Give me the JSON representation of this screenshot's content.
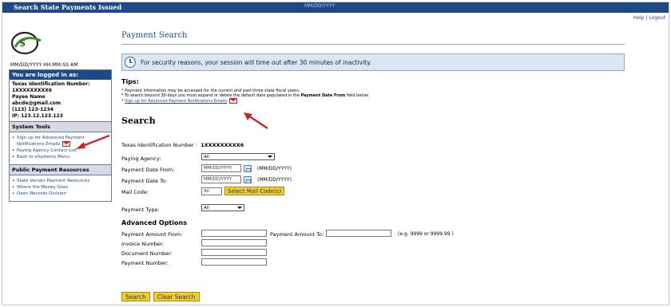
{
  "header": {
    "app_title": "Search State Payments Issued",
    "center_text": "MM/DD/YYYY",
    "help": "Help",
    "separator": "|",
    "logout": "Logout"
  },
  "sidebar": {
    "datetime": "MM/DD/YYYY  HH:MM:SS AM",
    "logged_in_heading": "You are logged in as:",
    "tin_label": "Texas Identification Number:",
    "tin_value": "1XXXXXXXXX6",
    "payee_name": "Payee Name",
    "email": "abcde@gmail.com",
    "phone": "(123) 123-1234",
    "ip": "IP: 123.12.123.123",
    "system_tools_heading": "System Tools",
    "system_tools": [
      {
        "label": "Sign up for Advanced Payment Notifications Emails"
      },
      {
        "label": "Paying Agency Contact List"
      },
      {
        "label": "Back to eSystems Menu"
      }
    ],
    "public_resources_heading": "Public Payment Resources",
    "public_resources": [
      {
        "label": "State Vendor Payment Resources"
      },
      {
        "label": "Where the Money Goes"
      },
      {
        "label": "Open Records Division"
      }
    ]
  },
  "main": {
    "page_title": "Payment Search",
    "timeout_notice": "For security reasons, your session will time out after 30 minutes of inactivity.",
    "tips_heading": "Tips:",
    "tip1": "* Payment information may be accessed for the current and past three state fiscal years.",
    "tip2_prefix": "* To search beyond 30-days you must expand or delete the default date populated in the ",
    "tip2_bold": "Payment Date From",
    "tip2_suffix": " field below.",
    "tip3_prefix": "* ",
    "tip3_link": "Sign up for Advanced Payment Notifications Emails",
    "search_heading": "Search",
    "tin_label": "Texas Identification Number :",
    "tin_value": "1XXXXXXXXX6",
    "paying_agency_label": "Paying Agency:",
    "paying_agency_value": "All",
    "date_from_label": "Payment Date From:",
    "date_from_value": "MM/DD/YYYY",
    "date_to_label": "Payment Date To:",
    "date_to_value": "MM/DD/YYYY",
    "date_hint": "(MM/DD/YYYY)",
    "mail_code_label": "Mail Code:",
    "mail_code_value": "All",
    "select_mail_code_button": "Select Mail Code(s)",
    "payment_type_label": "Payment Type:",
    "payment_type_value": "All",
    "advanced_heading": "Advanced Options",
    "amount_from_label": "Payment Amount From:",
    "amount_to_label": "Payment Amount To:",
    "amount_hint": "(e.g. 9999 or 9999.99 )",
    "invoice_label": "Invoice Number:",
    "document_label": "Document Number:",
    "payment_number_label": "Payment Number:",
    "search_button": "Search",
    "clear_button": "Clear Search"
  },
  "colors": {
    "brand_blue": "#1d4a86",
    "button_yellow": "#f5cc2e",
    "annotation_red": "#c62828"
  }
}
